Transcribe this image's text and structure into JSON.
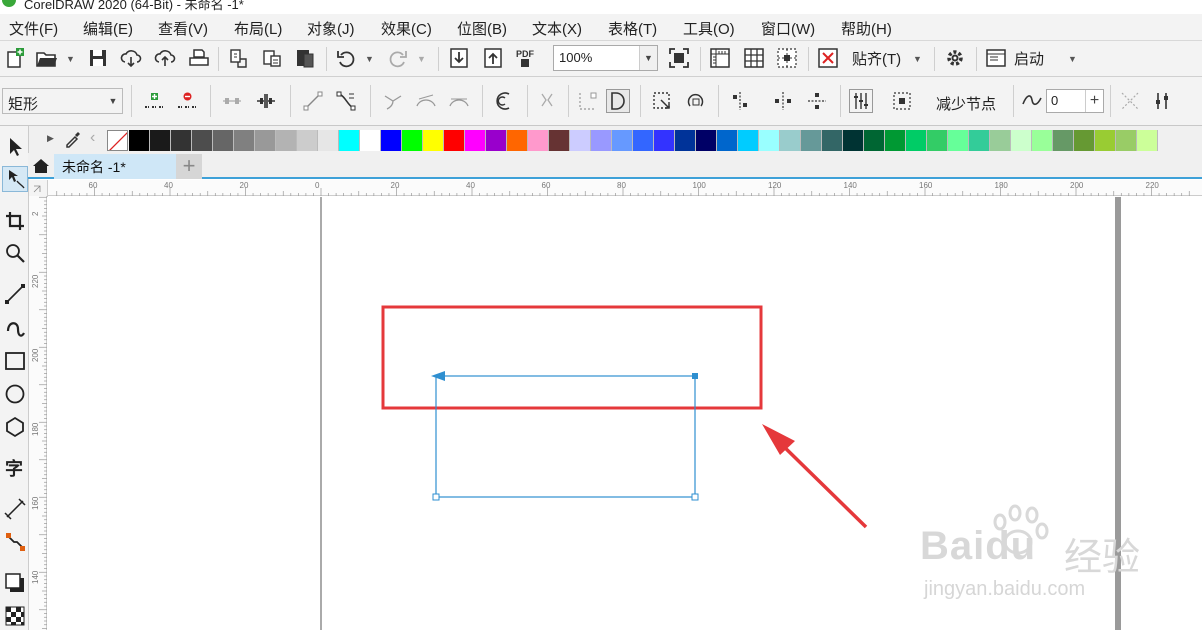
{
  "window": {
    "title": "CorelDRAW 2020 (64-Bit) - 未命名 -1*"
  },
  "menu": [
    "文件(F)",
    "编辑(E)",
    "查看(V)",
    "布局(L)",
    "对象(J)",
    "效果(C)",
    "位图(B)",
    "文本(X)",
    "表格(T)",
    "工具(O)",
    "窗口(W)",
    "帮助(H)"
  ],
  "toolbar": {
    "zoom_value": "100%",
    "snap_label": "贴齐(T)",
    "launch_label": "启动"
  },
  "propbar": {
    "shape_type": "矩形",
    "reduce_nodes_label": "减少节点",
    "smoothness_value": "0"
  },
  "palette": [
    "#000000",
    "#1a1a1a",
    "#333333",
    "#4d4d4d",
    "#666666",
    "#808080",
    "#999999",
    "#b3b3b3",
    "#cccccc",
    "#e6e6e6",
    "#00ffff",
    "#ffffff",
    "#0000ff",
    "#00ff00",
    "#ffff00",
    "#ff0000",
    "#ff00ff",
    "#9900cc",
    "#ff6600",
    "#ff99cc",
    "#663333",
    "#ccccff",
    "#9999ff",
    "#6699ff",
    "#3366ff",
    "#3333ff",
    "#003399",
    "#000066",
    "#0066cc",
    "#00ccff",
    "#99ffff",
    "#99cccc",
    "#669999",
    "#336666",
    "#003333",
    "#006633",
    "#009933",
    "#00cc66",
    "#33cc66",
    "#66ff99",
    "#33cc99",
    "#99cc99",
    "#ccffcc",
    "#99ff99",
    "#669966",
    "#669933",
    "#99cc33",
    "#99cc66",
    "#ccff99"
  ],
  "tabs": {
    "document_name": "未命名 -1*"
  },
  "ruler": {
    "h_labels": [
      "60",
      "40",
      "20",
      "0",
      "20",
      "40",
      "60",
      "80",
      "100",
      "120",
      "140",
      "160",
      "180",
      "200",
      "220"
    ],
    "v_labels": [
      "2",
      "220",
      "200",
      "180",
      "160",
      "140"
    ]
  },
  "watermark": {
    "brand": "Baidu",
    "cn": "经验",
    "url": "jingyan.baidu.com"
  },
  "colors": {
    "accent": "#3ea1d8",
    "annotation": "#e5383b",
    "selection": "#2e8fd0"
  }
}
